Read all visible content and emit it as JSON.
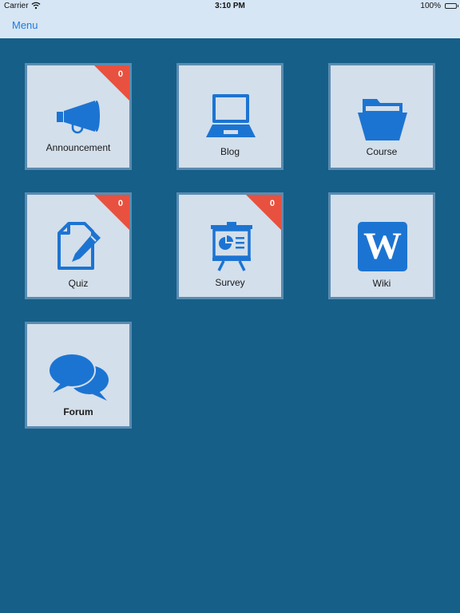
{
  "status_bar": {
    "carrier": "Carrier",
    "time": "3:10 PM",
    "battery": "100%"
  },
  "nav": {
    "menu_label": "Menu"
  },
  "tiles": [
    {
      "label": "Announcement",
      "icon": "megaphone-icon",
      "badge": "0"
    },
    {
      "label": "Blog",
      "icon": "laptop-icon"
    },
    {
      "label": "Course",
      "icon": "folder-icon"
    },
    {
      "label": "Quiz",
      "icon": "document-pencil-icon",
      "badge": "0"
    },
    {
      "label": "Survey",
      "icon": "presentation-board-icon",
      "badge": "0"
    },
    {
      "label": "Wiki",
      "icon": "wiki-icon",
      "icon_text": "W"
    },
    {
      "label": "Forum",
      "icon": "chat-bubbles-icon"
    }
  ],
  "colors": {
    "background": "#165f88",
    "bar": "#d6e6f4",
    "tile": "#d3dfeb",
    "tile_border": "#5a8bb0",
    "icon": "#1c74d2",
    "badge": "#e8513f",
    "link": "#1e7be0"
  }
}
